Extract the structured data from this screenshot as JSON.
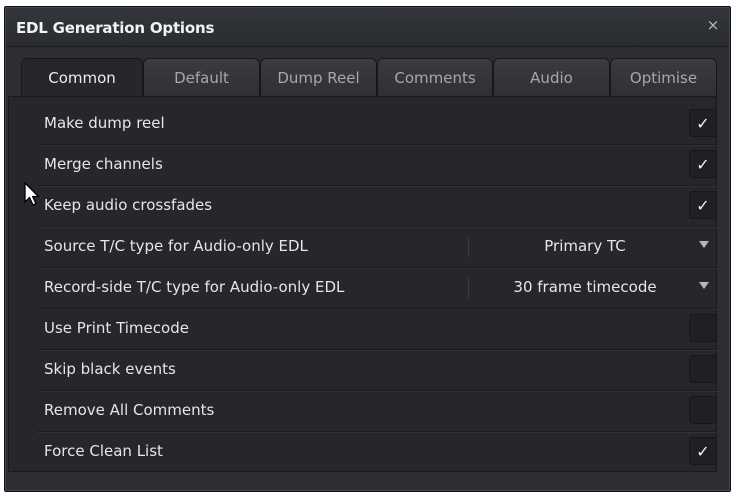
{
  "window": {
    "title": "EDL Generation Options",
    "close_glyph": "×"
  },
  "tabs": [
    "Common",
    "Default",
    "Dump Reel",
    "Comments",
    "Audio",
    "Optimise"
  ],
  "active_tab": "Common",
  "rows": [
    {
      "label": "Make dump reel",
      "type": "checkbox",
      "checked": true,
      "mark": "✓"
    },
    {
      "label": "Merge channels",
      "type": "checkbox",
      "checked": true,
      "mark": "✓"
    },
    {
      "label": "Keep audio crossfades",
      "type": "checkbox",
      "checked": true,
      "mark": "✓"
    },
    {
      "label": "Source T/C type for Audio-only EDL",
      "type": "select",
      "value": "Primary TC"
    },
    {
      "label": "Record-side T/C type for Audio-only EDL",
      "type": "select",
      "value": "30 frame timecode"
    },
    {
      "label": "Use Print Timecode",
      "type": "checkbox",
      "checked": false,
      "mark": ""
    },
    {
      "label": "Skip black events",
      "type": "checkbox",
      "checked": false,
      "mark": ""
    },
    {
      "label": "Remove All Comments",
      "type": "checkbox",
      "checked": false,
      "mark": ""
    },
    {
      "label": "Force Clean List",
      "type": "checkbox",
      "checked": true,
      "mark": "✓"
    }
  ],
  "colors": {
    "background": "#2c2e33",
    "panel": "#25272b",
    "text": "#e6e6e6"
  }
}
